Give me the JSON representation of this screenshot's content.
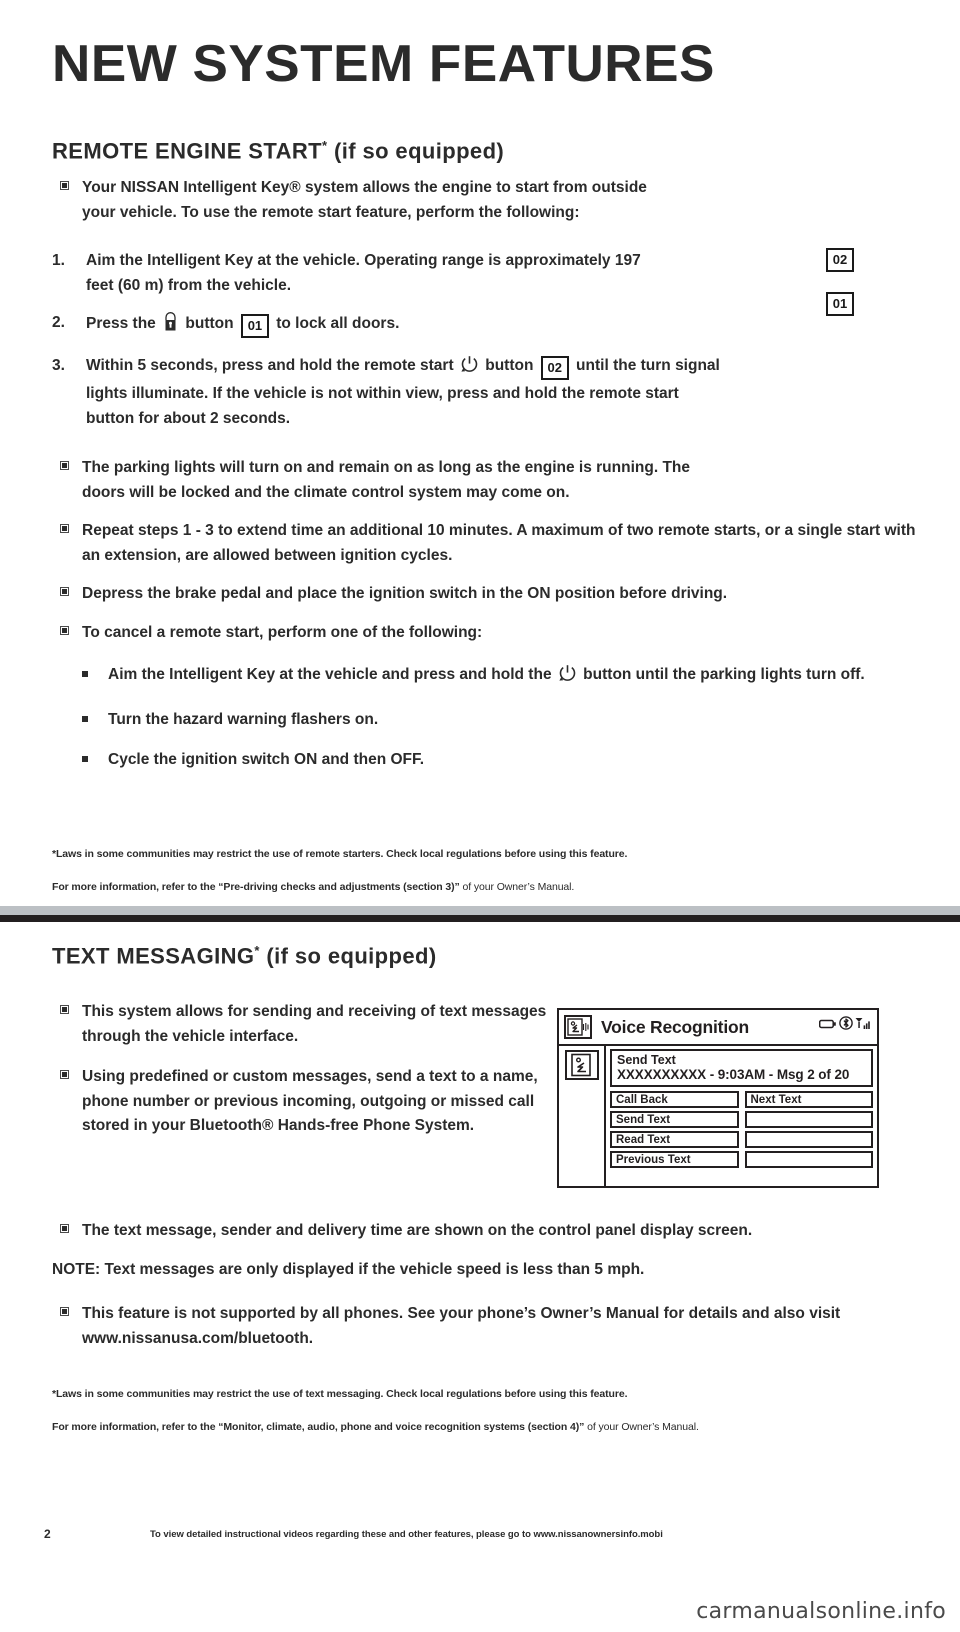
{
  "page": {
    "title": "NEW SYSTEM FEATURES",
    "number": "2",
    "footer_note": "To view detailed instructional videos regarding these and other features, please go to www.nissanownersinfo.mobi",
    "watermark": "carmanualsonline.info"
  },
  "section1": {
    "heading": "REMOTE ENGINE START",
    "heading_sup": "*",
    "heading_suffix": " (if so equipped)",
    "intro": "Your NISSAN Intelligent Key® system allows the engine to start from outside your vehicle. To use the remote start feature, perform the following:",
    "steps": [
      {
        "num": "1.",
        "text_a": "Aim the Intelligent Key at the vehicle. Operating range is approximately 197 feet (60 m) from the vehicle.",
        "badge": ""
      },
      {
        "num": "2.",
        "text_a": "Press the ",
        "icon": "lock-icon",
        "text_b": " button ",
        "badge": "01",
        "text_c": " to lock all doors."
      },
      {
        "num": "3.",
        "text_a": "Within 5 seconds, press and hold the remote start ",
        "icon": "remote-start-icon",
        "text_b": " button ",
        "badge": "02",
        "text_c": " until the turn signal lights illuminate. If the vehicle is not within view, press and hold the remote start button for about 2 seconds."
      }
    ],
    "bullets": [
      "The parking lights will turn on and remain on as long as the engine is running. The doors will be locked and the climate control system may come on.",
      "Repeat steps 1 - 3 to extend time an additional 10 minutes. A maximum of two remote starts, or a single start with an extension, are allowed between ignition cycles.",
      "Depress the brake pedal and place the ignition switch in the ON position before driving.",
      "To cancel a remote start, perform one of the following:"
    ],
    "subbullets": [
      {
        "text_a": "Aim the Intelligent Key at the vehicle and press and hold the ",
        "icon": "remote-start-icon",
        "text_b": " button until the parking lights turn off."
      },
      {
        "text_a": "Turn the hazard warning flashers on.",
        "icon": "",
        "text_b": ""
      },
      {
        "text_a": "Cycle the ignition switch ON and then OFF.",
        "icon": "",
        "text_b": ""
      }
    ],
    "footnote1": "*Laws in some communities may restrict the use of remote starters. Check local regulations before using this feature.",
    "footnote2_a": "For more information, refer to the ",
    "footnote2_b": "“Pre-driving checks and adjustments (section 3)”",
    "footnote2_c": " of your Owner’s Manual."
  },
  "callouts": {
    "badge_02": "02",
    "badge_01": "01"
  },
  "section2": {
    "heading": "TEXT MESSAGING",
    "heading_sup": "*",
    "heading_suffix": " (if so equipped)",
    "bullets": [
      "This system allows for sending and receiving of text messages through the vehicle interface.",
      "Using predefined or custom messages, send a text to a name, phone number or previous incoming, outgoing or missed call stored in your Bluetooth® Hands-free Phone System.",
      "The text message, sender and delivery time are shown on the control panel display screen."
    ],
    "note": "NOTE: Text messages are only displayed if the vehicle speed is less than 5 mph.",
    "bullet_last_a": "This feature is not supported by all phones. See your phone’s Owner’s Manual for details and also visit ",
    "bullet_last_b": "www.nissanusa.com/bluetooth.",
    "footnote1": "*Laws in some communities may restrict the use of text messaging. Check local regulations before using this feature.",
    "footnote2_a": "For more information, refer to the ",
    "footnote2_b": "“Monitor, climate, audio, phone and voice recognition systems (section 4)”",
    "footnote2_c": " of your Owner’s Manual."
  },
  "display_screen": {
    "title": "Voice Recognition",
    "vr_icon": "voice-head-icon",
    "status_icons": [
      "battery-icon",
      "bluetooth-icon",
      "signal-icon"
    ],
    "message_icon": "message-head-icon",
    "message_line1": "Send Text",
    "message_line2": "XXXXXXXXXX  - 9:03AM  -  Msg 2 of 20",
    "buttons_left": [
      "Call Back",
      "Send Text",
      "Read Text",
      "Previous Text"
    ],
    "buttons_right": [
      "Next Text",
      "",
      "",
      ""
    ]
  }
}
